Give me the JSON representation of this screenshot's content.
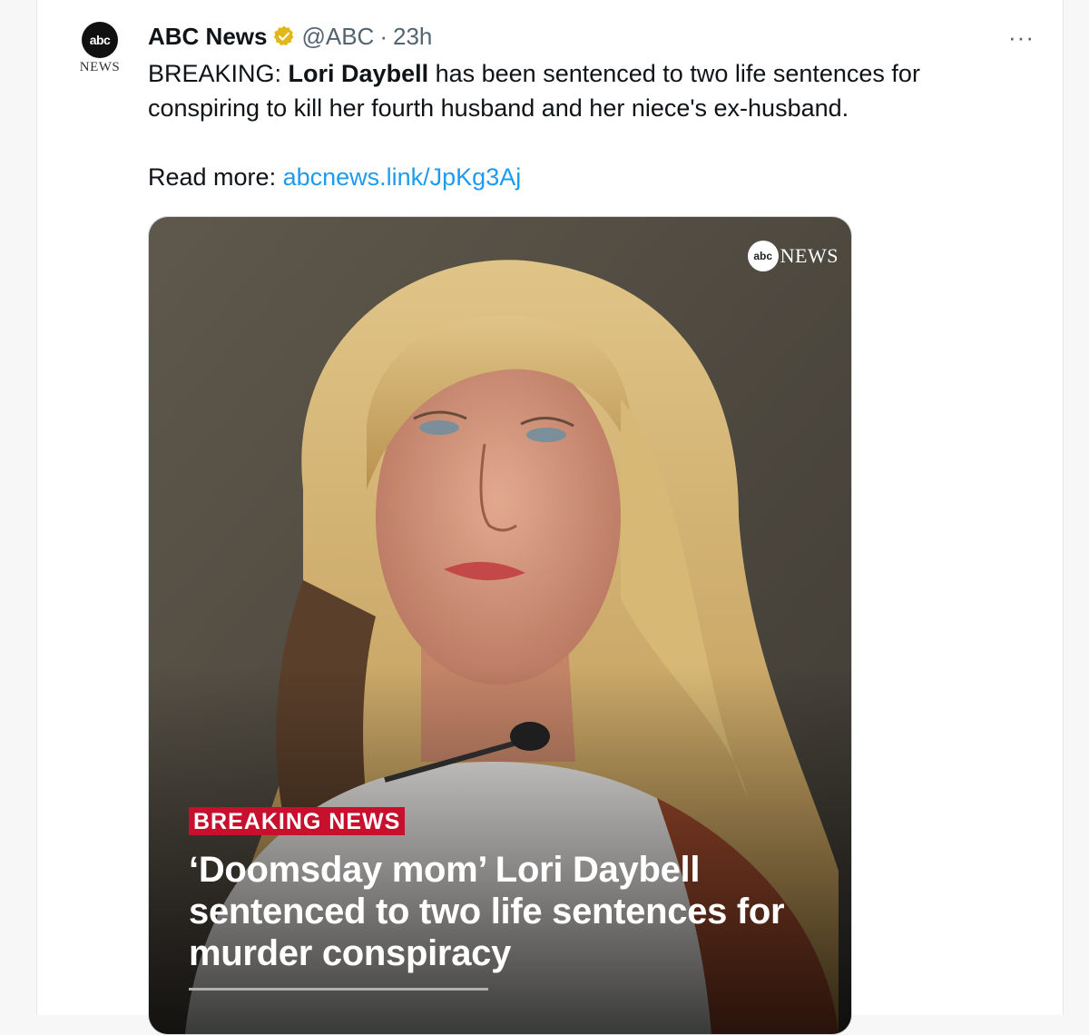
{
  "tweet": {
    "avatar": {
      "logo_text": "abc",
      "news_text": "NEWS"
    },
    "author_name": "ABC News",
    "verified_icon": "verified-badge-gold",
    "handle": "@ABC",
    "separator": "·",
    "time": "23h",
    "more_icon": "···",
    "text_prefix": "BREAKING: ",
    "text_bold": "Lori Daybell",
    "text_rest": " has been sentenced to two life sentences for conspiring to kill her fourth husband and her niece's ex-husband.",
    "read_more_label": "Read more: ",
    "read_more_link": "abcnews.link/JpKg3Aj"
  },
  "media": {
    "watermark_logo": "abc",
    "watermark_news": "NEWS",
    "badge": "BREAKING NEWS",
    "headline": "‘Doomsday mom’ Lori Daybell sentenced to two life sentences for murder conspiracy"
  },
  "colors": {
    "link": "#1d9bf0",
    "badge_red": "#c8102e",
    "verified_gold": "#e2b719"
  }
}
